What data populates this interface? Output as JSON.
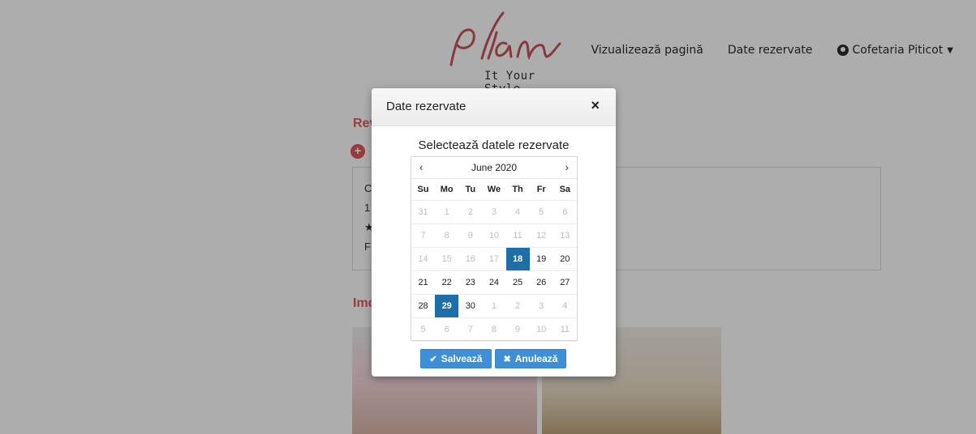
{
  "header": {
    "logo_tag": "It Your Style",
    "nav": {
      "view_page": "Vizualizează pagină",
      "reserved_dates": "Date rezervate",
      "user": "Cofetaria Piticot"
    }
  },
  "background": {
    "section_titles": [
      "Rev",
      "Imc"
    ],
    "review_lines": [
      "C",
      "1",
      "★",
      "F"
    ]
  },
  "modal": {
    "title": "Date rezervate",
    "close_label": "×",
    "subtitle": "Selectează datele rezervate",
    "calendar": {
      "month": "June 2020",
      "prev": "‹",
      "next": "›",
      "dow": [
        "Su",
        "Mo",
        "Tu",
        "We",
        "Th",
        "Fr",
        "Sa"
      ],
      "weeks": [
        [
          "31",
          "1",
          "2",
          "3",
          "4",
          "5",
          "6"
        ],
        [
          "7",
          "8",
          "9",
          "10",
          "11",
          "12",
          "13"
        ],
        [
          "14",
          "15",
          "16",
          "17",
          "18",
          "19",
          "20"
        ],
        [
          "21",
          "22",
          "23",
          "24",
          "25",
          "26",
          "27"
        ],
        [
          "28",
          "29",
          "30",
          "1",
          "2",
          "3",
          "4"
        ],
        [
          "5",
          "6",
          "7",
          "8",
          "9",
          "10",
          "11"
        ]
      ],
      "selected": [
        "18",
        "29"
      ]
    },
    "buttons": {
      "save": "Salvează",
      "cancel": "Anulează"
    }
  },
  "colors": {
    "accent": "#3f8fd6",
    "selected_day": "#1f6ea7",
    "brand_red": "#c9555a"
  }
}
